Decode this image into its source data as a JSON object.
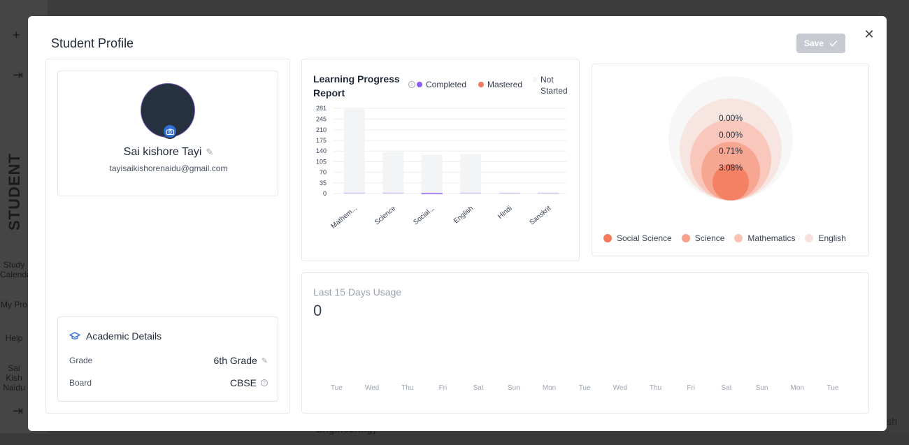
{
  "background": {
    "brand": "STUDENT",
    "sidebar_items": [
      "Study Calendar",
      "My Pro",
      "Help",
      "Sai Kish Naidu"
    ],
    "bottom_text": "Engineering)",
    "right_text": "lish"
  },
  "modal": {
    "title": "Student Profile",
    "save_label": "Save",
    "close_label": "✕"
  },
  "profile": {
    "name": "Sai kishore Tayi",
    "email": "tayisaikishorenaidu@gmail.com"
  },
  "academic": {
    "title": "Academic Details",
    "grade_label": "Grade",
    "grade_value": "6th Grade",
    "board_label": "Board",
    "board_value": "CBSE"
  },
  "progress": {
    "title": "Learning Progress Report",
    "legend": {
      "completed": "Completed",
      "mastered": "Mastered",
      "not_started": "Not Started"
    }
  },
  "colors": {
    "completed": "#8b5cf6",
    "mastered": "#f4775f",
    "not_started": "#f3f4f6",
    "social_science": "#f57a5c",
    "science": "#f7a08a",
    "mathematics": "#f9c2b4",
    "english": "#f6e2dc"
  },
  "chart_data": [
    {
      "type": "bar",
      "categories": [
        "Mathem...",
        "Science",
        "Social...",
        "English",
        "Hindi",
        "Sanskrit"
      ],
      "series": [
        {
          "name": "Completed",
          "values": [
            0,
            0,
            1,
            0,
            0,
            0
          ]
        },
        {
          "name": "Mastered",
          "values": [
            0,
            0,
            0,
            0,
            0,
            0
          ]
        },
        {
          "name": "Not Started",
          "values": [
            281,
            137,
            127,
            130,
            0,
            0
          ]
        }
      ],
      "y_ticks": [
        "281",
        "245",
        "210",
        "175",
        "140",
        "105",
        "70",
        "35",
        "0"
      ],
      "ylim": [
        0,
        281
      ],
      "legend": "top-right",
      "grid": true
    },
    {
      "type": "pie",
      "categories": [
        "Social Science",
        "Science",
        "Mathematics",
        "English"
      ],
      "values": [
        3.08,
        0.71,
        0.0,
        0.0
      ],
      "labels": [
        "3.08%",
        "0.71%",
        "0.00%",
        "0.00%"
      ],
      "legend": "bottom"
    }
  ],
  "usage": {
    "title": "Last 15 Days Usage",
    "value": "0",
    "days": [
      "Tue",
      "Wed",
      "Thu",
      "Fri",
      "Sat",
      "Sun",
      "Mon",
      "Tue",
      "Wed",
      "Thu",
      "Fri",
      "Sat",
      "Sun",
      "Mon",
      "Tue"
    ]
  }
}
